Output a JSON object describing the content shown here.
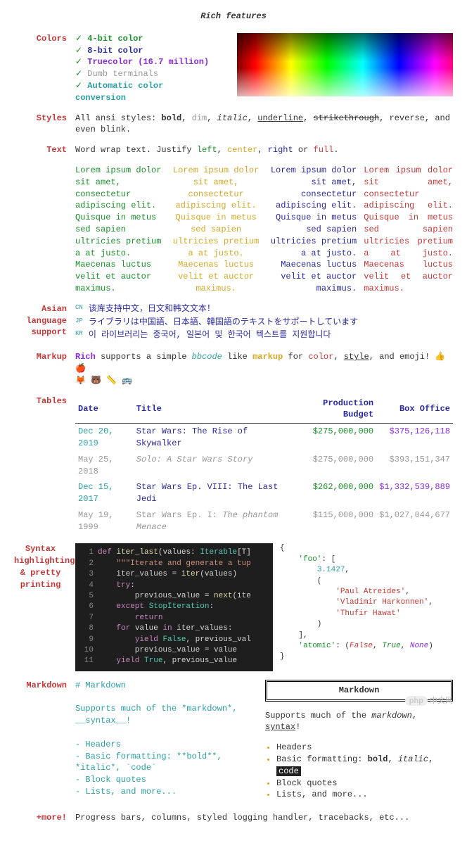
{
  "title": "Rich features",
  "sections": {
    "colors": {
      "label": "Colors",
      "items": [
        {
          "check": "✓",
          "text": "4-bit color",
          "cls": "darkgreen bold"
        },
        {
          "check": "✓",
          "text": "8-bit color",
          "cls": "navy bold"
        },
        {
          "check": "✓",
          "text": "Truecolor (16.7 million)",
          "cls": "purple bold"
        },
        {
          "check": "✓",
          "text": "Dumb terminals",
          "cls": "dim"
        },
        {
          "check": "✓",
          "text": "Automatic color conversion",
          "cls": "teal bold"
        }
      ]
    },
    "styles": {
      "label": "Styles",
      "prefix": "All ansi styles: ",
      "bold": "bold",
      "dim": "dim",
      "italic": "italic",
      "underline": "underline",
      "strike": "strikethrough",
      "reverse": "reverse",
      "suffix": ", and even blink."
    },
    "text": {
      "label": "Text",
      "parts": [
        "Word wrap text. Justify ",
        "left",
        ", ",
        "center",
        ", ",
        "right",
        " or ",
        "full",
        "."
      ]
    },
    "lorem": "Lorem ipsum dolor sit amet, consectetur adipiscing elit. Quisque in metus sed sapien ultricies pretium a at justo. Maecenas luctus velit et auctor maximus.",
    "asian": {
      "label": "Asian language support",
      "rows": [
        {
          "tag": "CN",
          "text": "该库支持中文，日文和韩文文本！"
        },
        {
          "tag": "JP",
          "text": "ライブラリは中国語、日本語、韓国語のテキストをサポートしています"
        },
        {
          "tag": "KR",
          "text": "이 라이브러리는 중국어, 일본어 및 한국어 텍스트를 지원합니다"
        }
      ]
    },
    "markup": {
      "label": "Markup",
      "pre": "Rich",
      "mid1": " supports a simple ",
      "bbcode": "bbcode",
      "mid2": " like ",
      "markup_word": "markup",
      "mid3": " for ",
      "color": "color",
      "sep": ", ",
      "style": "style",
      "end": ", and emoji! 👍 🍎",
      "emoji_row": "🦊 🐻 📏 🚌"
    },
    "tables": {
      "label": "Tables",
      "headers": [
        "Date",
        "Title",
        "Production Budget",
        "Box Office"
      ],
      "rows": [
        {
          "date": "Dec 20, 2019",
          "title": "Star Wars: The Rise of Skywalker",
          "budget": "$275,000,000",
          "box": "$375,126,118",
          "dim": false
        },
        {
          "date": "May 25, 2018",
          "title": "Solo: A Star Wars Story",
          "budget": "$275,000,000",
          "box": "$393,151,347",
          "dim": true,
          "title_italic": true
        },
        {
          "date": "Dec 15, 2017",
          "title": "Star Wars Ep. VIII: The Last Jedi",
          "budget": "$262,000,000",
          "box": "$1,332,539,889",
          "dim": false
        },
        {
          "date": "May 19, 1999",
          "title_pre": "Star Wars Ep. I: ",
          "title_it": "The phantom Menace",
          "budget": "$115,000,000",
          "box": "$1,027,044,677",
          "dim": true
        }
      ]
    },
    "syntax": {
      "label": "Syntax highlighting & pretty printing",
      "code_lines": [
        "def iter_last(values: Iterable[T]",
        "    \"\"\"Iterate and generate a tup",
        "    iter_values = iter(values)",
        "    try:",
        "        previous_value = next(ite",
        "    except StopIteration:",
        "        return",
        "    for value in iter_values:",
        "        yield False, previous_val",
        "        previous_value = value",
        "    yield True, previous_value"
      ],
      "pretty": {
        "open": "{",
        "foo_key": "'foo'",
        "num": "3.1427",
        "s1": "'Paul Atreides'",
        "s2": "'Vladimir Harkonnen'",
        "s3": "'Thufir Hawat'",
        "atomic_key": "'atomic'",
        "false": "False",
        "true": "True",
        "none": "None",
        "close": "}"
      }
    },
    "markdown": {
      "label": "Markdown",
      "raw": "# Markdown\n\nSupports much of the *markdown*, __syntax__!\n\n- Headers\n- Basic formatting: **bold**, *italic*, `code`\n- Block quotes\n- Lists, and more...",
      "render": {
        "h": "Markdown",
        "p_pre": "Supports much of the ",
        "p_it": "markdown",
        "p_mid": ", ",
        "p_u": "syntax",
        "p_end": "!",
        "li1": "Headers",
        "li2_pre": "Basic formatting: ",
        "li2_b": "bold",
        "li2_sep": ", ",
        "li2_it": "italic",
        "li2_sep2": ", ",
        "li2_code": "code",
        "li3": "Block quotes",
        "li4": "Lists, and more..."
      }
    },
    "more": {
      "label": "+more!",
      "text": "Progress bars, columns, styled logging handler, tracebacks, etc..."
    }
  },
  "watermark": {
    "php": "php",
    "cn": "中文网"
  }
}
